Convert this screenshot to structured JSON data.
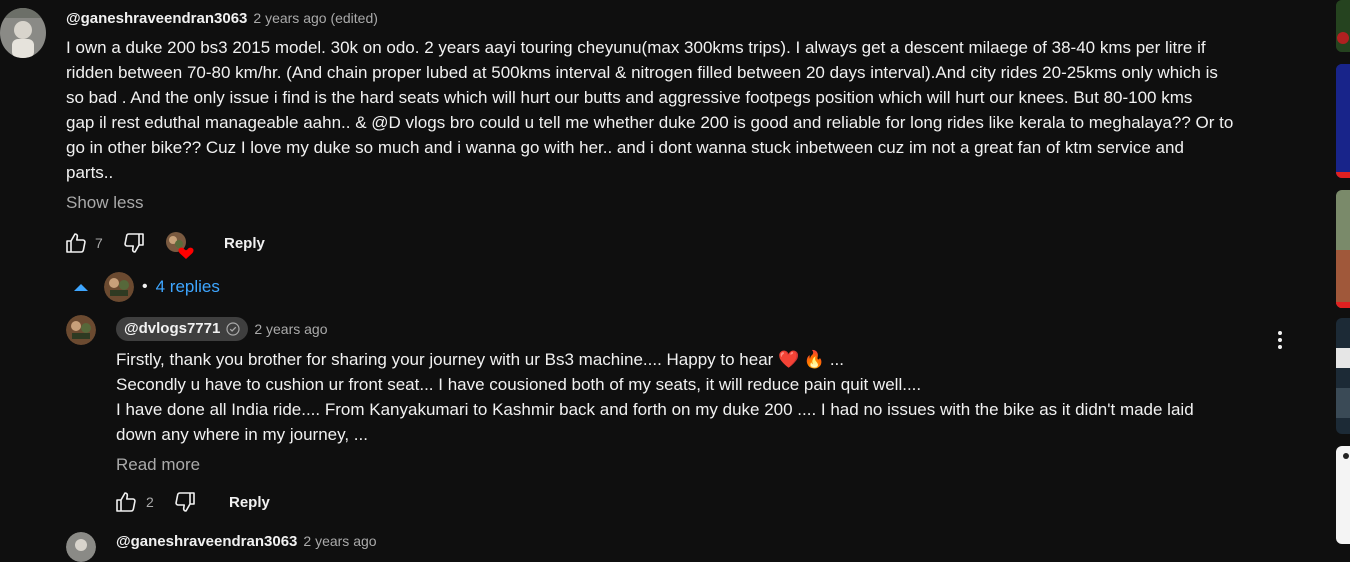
{
  "comment": {
    "author": "@ganeshraveendran3063",
    "time": "2 years ago (edited)",
    "lines": [
      "I own a duke 200 bs3 2015 model. 30k on odo.  2 years aayi touring cheyunu(max 300kms trips). I always get a descent milaege of 38-40 kms per litre if",
      "ridden between 70-80 km/hr. (And chain proper lubed at 500kms interval & nitrogen filled between 20 days interval).And city rides 20-25kms only which is",
      "so bad . And the only issue i find is the hard seats which will hurt our butts and aggressive footpegs position which will hurt our knees. But 80-100 kms",
      "gap il rest eduthal manageable aahn.. & @D vlogs bro could u tell me whether duke 200 is good and reliable for long rides like kerala to meghalaya?? Or to",
      "go in other bike?? Cuz I love my duke so much and i wanna go with her.. and i dont wanna stuck inbetween cuz im not a great fan of ktm service and",
      "parts.."
    ],
    "show_less": "Show less",
    "likes": "7",
    "reply_label": "Reply",
    "replies_toggle": "4 replies",
    "replies_dot": "•"
  },
  "reply": {
    "author": "@dvlogs7771",
    "time": "2 years ago",
    "lines": [
      "Firstly, thank you brother for sharing your journey with ur Bs3 machine.... Happy to hear ❤️ 🔥 ...",
      "Secondly u have to cushion ur front seat... I have cousioned both of my seats, it will reduce pain quit well....",
      "I have done all India ride.... From Kanyakumari to Kashmir back and forth on my duke 200 .... I had no issues with the bike as it didn't made laid",
      "down any where in my journey, ..."
    ],
    "read_more": "Read more",
    "likes": "2",
    "reply_label": "Reply"
  },
  "next_reply": {
    "author": "@ganeshraveendran3063",
    "time": "2 years ago"
  },
  "colors": {
    "background": "#0f0f0f",
    "text": "#f1f1f1",
    "secondary": "#aaaaaa",
    "link": "#3ea6ff",
    "heart": "#ff0000"
  },
  "icons": [
    "like-icon",
    "dislike-icon",
    "caret-up-icon",
    "verified-icon",
    "more-vert-icon",
    "heart-icon"
  ]
}
